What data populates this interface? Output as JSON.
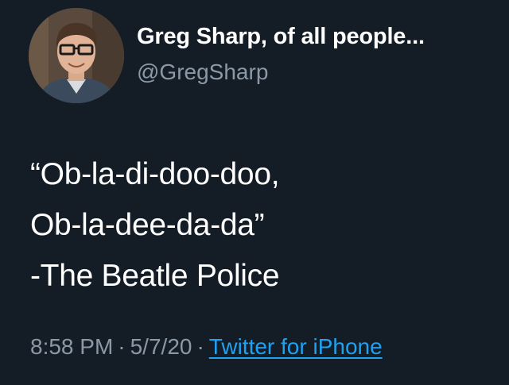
{
  "tweet": {
    "author": {
      "display_name": "Greg Sharp, of all people...",
      "handle": "@GregSharp",
      "avatar": "avatar-photo"
    },
    "text_lines": [
      "“Ob-la-di-doo-doo,",
      "Ob-la-dee-da-da”",
      "-The Beatle Police"
    ],
    "time": "8:58 PM",
    "date": "5/7/20",
    "separator": "·",
    "source": "Twitter for iPhone"
  },
  "colors": {
    "background": "#141d26",
    "primary_text": "#ffffff",
    "secondary_text": "#8b98a5",
    "link": "#1da1f2"
  }
}
